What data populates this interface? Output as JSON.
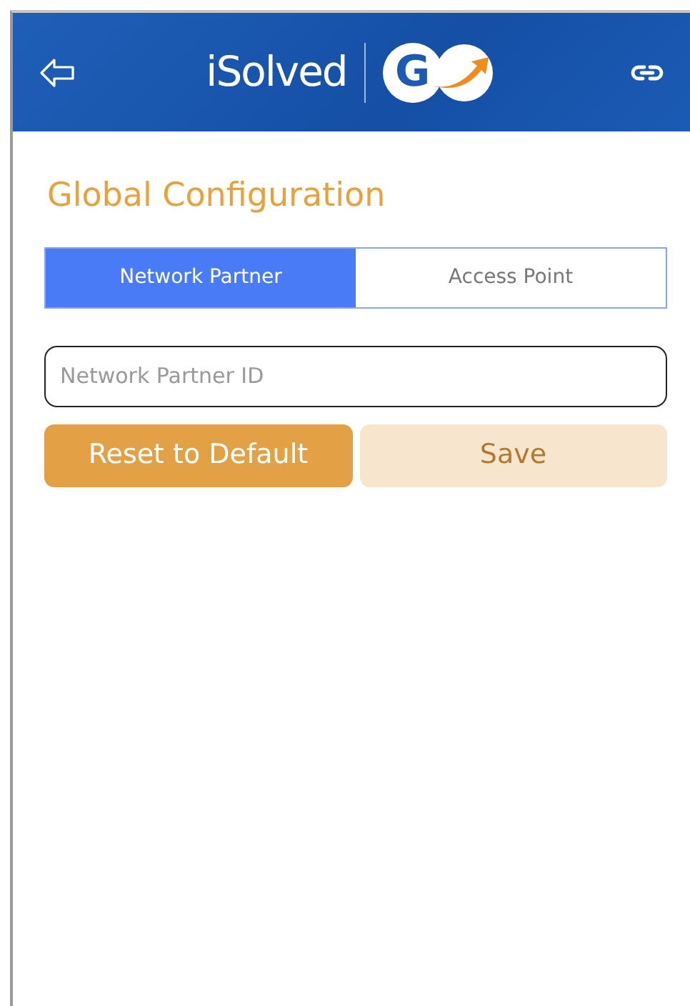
{
  "header": {
    "brand": "iSolved",
    "logo_letter": "G"
  },
  "title": "Global Configuration",
  "tabs": [
    {
      "label": "Network Partner",
      "selected": true
    },
    {
      "label": "Access Point",
      "selected": false
    }
  ],
  "field": {
    "placeholder": "Network Partner ID"
  },
  "buttons": [
    {
      "label": "Reset to Default",
      "disabled": false
    },
    {
      "label": "Save",
      "disabled": true
    }
  ]
}
